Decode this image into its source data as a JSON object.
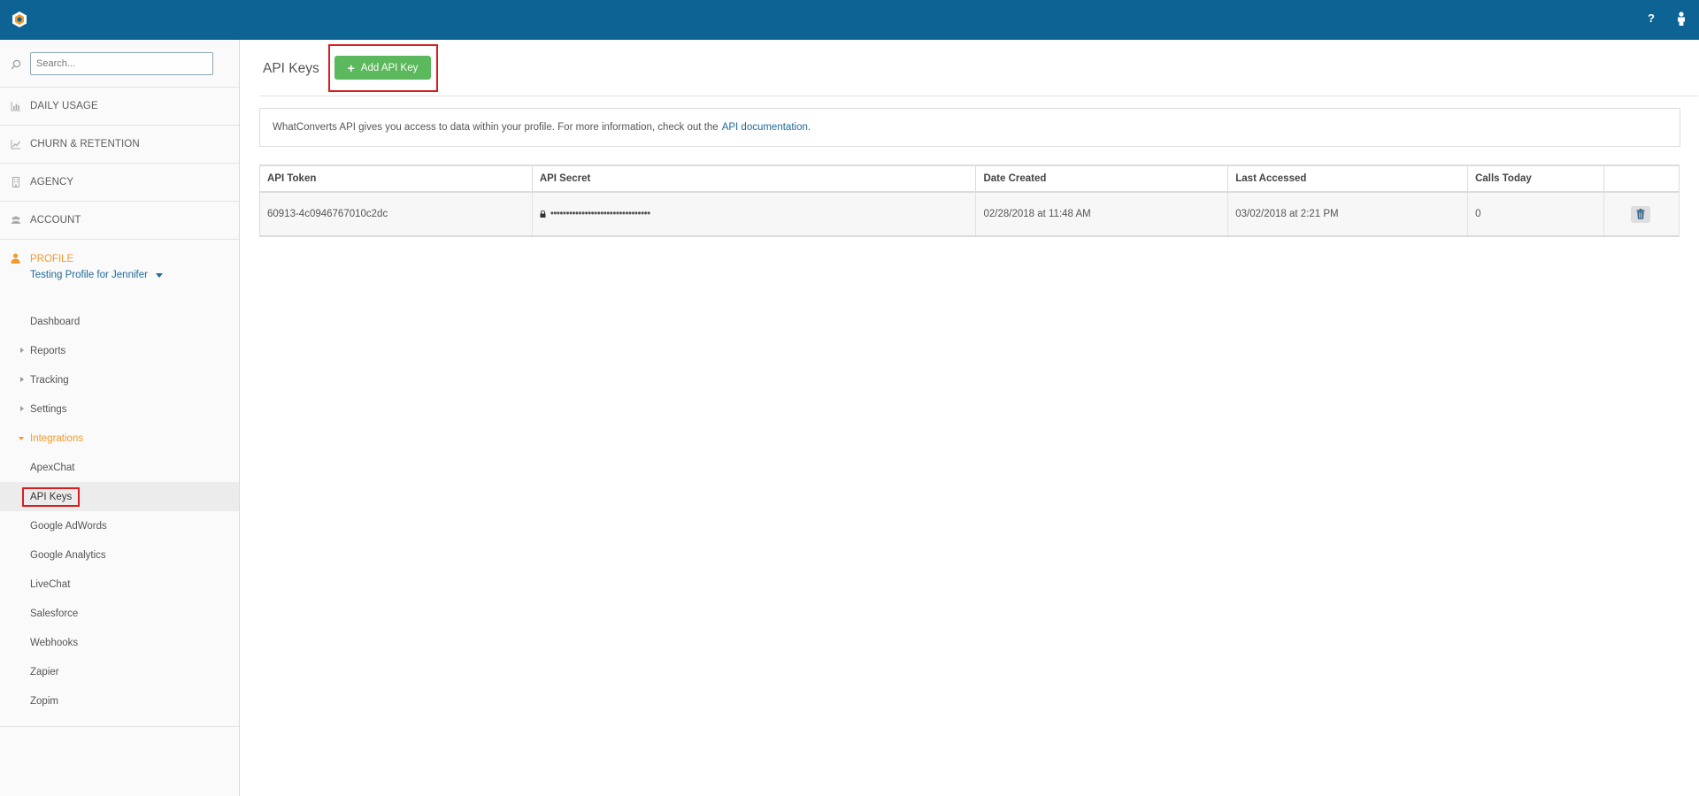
{
  "topbar": {
    "help_label": "?"
  },
  "sidebar": {
    "search_placeholder": "Search...",
    "sections": [
      {
        "label": "DAILY USAGE",
        "icon": "bar-chart-icon"
      },
      {
        "label": "CHURN & RETENTION",
        "icon": "line-chart-icon"
      },
      {
        "label": "AGENCY",
        "icon": "building-icon"
      },
      {
        "label": "ACCOUNT",
        "icon": "users-icon"
      }
    ],
    "profile": {
      "label": "PROFILE",
      "selected_profile": "Testing Profile for Jennifer",
      "items": [
        "Dashboard",
        "Reports",
        "Tracking",
        "Settings",
        "Integrations"
      ],
      "integrations": [
        "ApexChat",
        "API Keys",
        "Google AdWords",
        "Google Analytics",
        "LiveChat",
        "Salesforce",
        "Webhooks",
        "Zapier",
        "Zopim"
      ]
    },
    "colors": {
      "accent": "#f09a2b",
      "link": "#1f6a9a"
    }
  },
  "main": {
    "title": "API Keys",
    "add_button_label": "Add API Key",
    "info_text": "WhatConverts API gives you access to data within your profile. For more information, check out the",
    "info_link": "API documentation",
    "info_tail": ".",
    "table": {
      "headers": [
        "API Token",
        "API Secret",
        "Date Created",
        "Last Accessed",
        "Calls Today",
        ""
      ],
      "rows": [
        {
          "token": "60913-4c0946767010c2dc",
          "secret": "••••••••••••••••••••••••••••••••",
          "date_created": "02/28/2018 at 11:48 AM",
          "last_accessed": "03/02/2018 at 2:21 PM",
          "calls_today": "0"
        }
      ]
    },
    "colors": {
      "topbar": "#0d6494",
      "button": "#5cb85c",
      "highlight": "#d81e1e"
    }
  }
}
